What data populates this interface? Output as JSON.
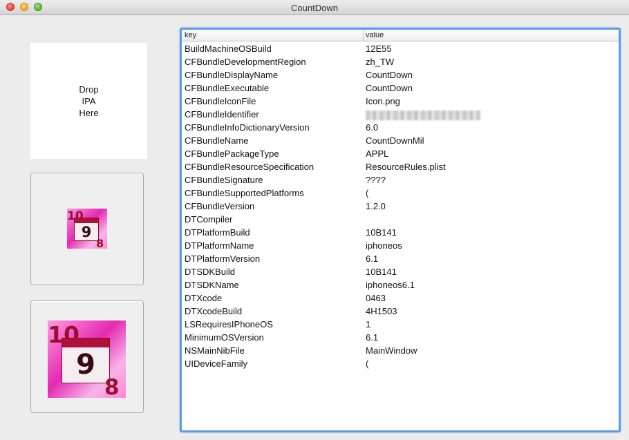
{
  "window": {
    "title": "CountDown"
  },
  "drop_zone": {
    "text": "Drop\nIPA\nHere"
  },
  "icon_small": {
    "top_digit": "10",
    "center_digit": "9",
    "bottom_digit": "8"
  },
  "icon_large": {
    "top_digit": "10",
    "center_digit": "9",
    "bottom_digit": "8"
  },
  "table": {
    "columns": [
      "key",
      "value"
    ],
    "rows": [
      {
        "key": "BuildMachineOSBuild",
        "value": "12E55"
      },
      {
        "key": "CFBundleDevelopmentRegion",
        "value": "zh_TW"
      },
      {
        "key": "CFBundleDisplayName",
        "value": "CountDown"
      },
      {
        "key": "CFBundleExecutable",
        "value": "CountDown"
      },
      {
        "key": "CFBundleIconFile",
        "value": "Icon.png"
      },
      {
        "key": "CFBundleIdentifier",
        "value": ""
      },
      {
        "key": "CFBundleInfoDictionaryVersion",
        "value": "6.0"
      },
      {
        "key": "CFBundleName",
        "value": "CountDownMil"
      },
      {
        "key": "CFBundlePackageType",
        "value": "APPL"
      },
      {
        "key": "CFBundleResourceSpecification",
        "value": "ResourceRules.plist"
      },
      {
        "key": "CFBundleSignature",
        "value": "????"
      },
      {
        "key": "CFBundleSupportedPlatforms",
        "value": "("
      },
      {
        "key": "CFBundleVersion",
        "value": "1.2.0"
      },
      {
        "key": "DTCompiler",
        "value": ""
      },
      {
        "key": "DTPlatformBuild",
        "value": "10B141"
      },
      {
        "key": "DTPlatformName",
        "value": "iphoneos"
      },
      {
        "key": "DTPlatformVersion",
        "value": "6.1"
      },
      {
        "key": "DTSDKBuild",
        "value": "10B141"
      },
      {
        "key": "DTSDKName",
        "value": "iphoneos6.1"
      },
      {
        "key": "DTXcode",
        "value": "0463"
      },
      {
        "key": "DTXcodeBuild",
        "value": "4H1503"
      },
      {
        "key": "LSRequiresIPhoneOS",
        "value": "1"
      },
      {
        "key": "MinimumOSVersion",
        "value": "6.1"
      },
      {
        "key": "NSMainNibFile",
        "value": "MainWindow"
      },
      {
        "key": "UIDeviceFamily",
        "value": "("
      }
    ]
  },
  "colors": {
    "focus_ring": "#5f9ae6",
    "icon_pink": "#e52ab2",
    "icon_red": "#b0103c"
  }
}
